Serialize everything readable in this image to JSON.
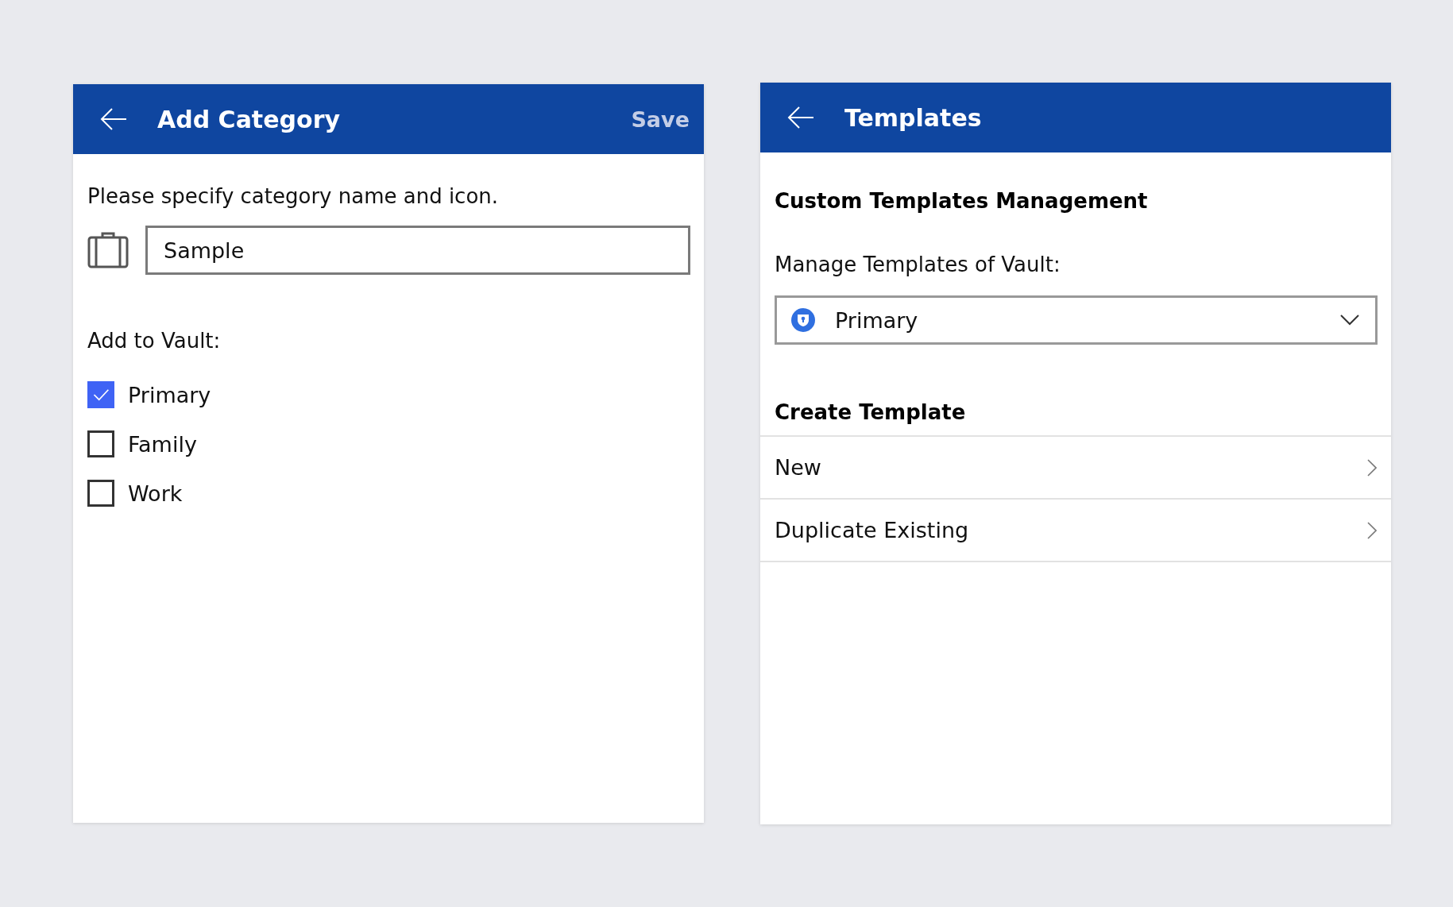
{
  "add_category": {
    "title": "Add Category",
    "save": "Save",
    "instruction": "Please specify category name and icon.",
    "name_field": {
      "value": "Sample"
    },
    "vault_label": "Add to Vault:",
    "vaults": [
      {
        "label": "Primary",
        "checked": true
      },
      {
        "label": "Family",
        "checked": false
      },
      {
        "label": "Work",
        "checked": false
      }
    ]
  },
  "templates": {
    "title": "Templates",
    "heading": "Custom Templates Management",
    "vault_label": "Manage Templates of Vault:",
    "vault_dropdown": {
      "value": "Primary"
    },
    "create_heading": "Create Template",
    "items": [
      {
        "label": "New"
      },
      {
        "label": "Duplicate Existing"
      }
    ]
  }
}
